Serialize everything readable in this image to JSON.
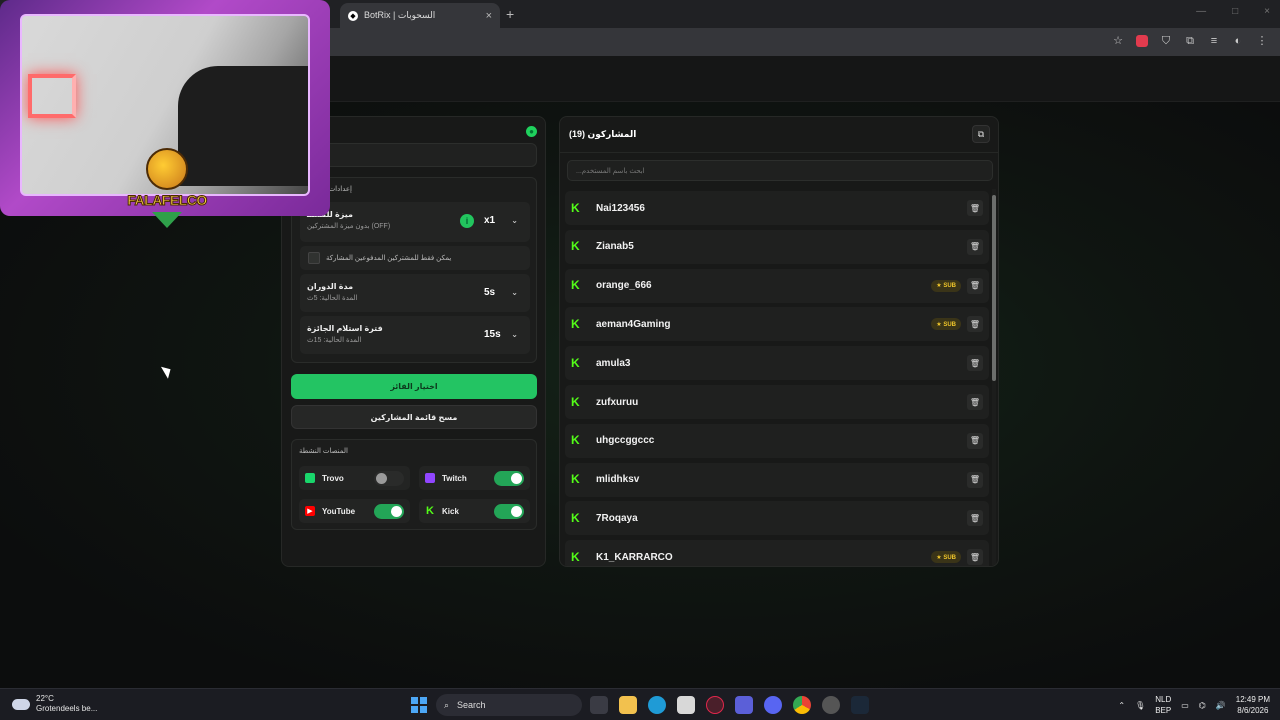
{
  "browser": {
    "tab_title": "BotRix | السحوبات",
    "tab_left_label": "‹",
    "close": "×",
    "new_tab": "+",
    "win_min": "—",
    "win_max": "□",
    "win_close": "×"
  },
  "left_panel": {
    "settings_title": "إعدادات",
    "feature": {
      "title": "ميزة للمشتـ",
      "subtitle": "بدون ميزة المشتركين (OFF)",
      "info": "i",
      "value": "x1"
    },
    "subs_only_label": "يمكن فقط للمشتركين المدفوعين المشاركة",
    "duration": {
      "title": "مدة الدوران",
      "subtitle": "المدة الحالية: 5ث",
      "value": "5s"
    },
    "claim": {
      "title": "فترة استلام الجائزة",
      "subtitle": "المدة الحالية: 15ث",
      "value": "15s"
    },
    "pick_winner": "اختيار الفائز",
    "clear_list": "مسح قائمة المشاركين",
    "platforms_title": "المنصات النشطة",
    "platforms": [
      {
        "name": "Trovo",
        "enabled": false,
        "color": "#19d66b"
      },
      {
        "name": "Twitch",
        "enabled": true,
        "color": "#9146ff"
      },
      {
        "name": "YouTube",
        "enabled": true,
        "color": "#ff0000"
      },
      {
        "name": "Kick",
        "enabled": true,
        "color": "#53fc18"
      }
    ]
  },
  "right_panel": {
    "title": "المشاركون (19)",
    "search_placeholder": "...ابحث باسم المستخدم",
    "sub_badge": "★ SUB",
    "participants": [
      {
        "name": "Nai123456",
        "sub": false
      },
      {
        "name": "Zianab5",
        "sub": false
      },
      {
        "name": "orange_666",
        "sub": true
      },
      {
        "name": "aeman4Gaming",
        "sub": true
      },
      {
        "name": "amula3",
        "sub": false
      },
      {
        "name": "zufxuruu",
        "sub": false
      },
      {
        "name": "uhgccggccc",
        "sub": false
      },
      {
        "name": "mlidhksv",
        "sub": false
      },
      {
        "name": "7Roqaya",
        "sub": false
      },
      {
        "name": "K1_KARRARCO",
        "sub": true
      }
    ]
  },
  "webcam": {
    "logo_text": "FALAFELCO"
  },
  "taskbar": {
    "temp": "22°C",
    "weather": "Grotendeels be...",
    "search": "Search",
    "lang1": "NLD",
    "lang2": "BEP",
    "time": "12:49 PM",
    "date": "8/6/2026"
  },
  "colors": {
    "accent_green": "#23c463",
    "kick_green": "#53fc18",
    "sub_gold": "#f0c62a"
  }
}
